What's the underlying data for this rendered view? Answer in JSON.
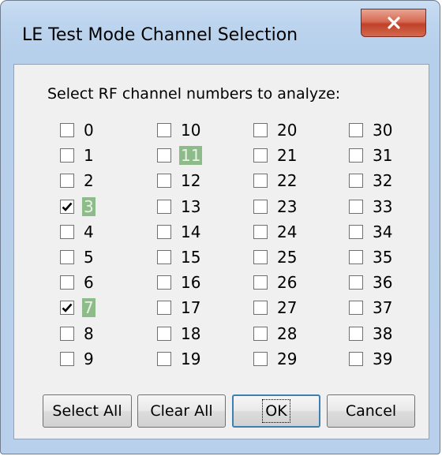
{
  "window": {
    "title": "LE Test Mode Channel Selection",
    "close_icon": "close-x"
  },
  "prompt": "Select RF channel numbers to analyze:",
  "highlight_color": "#8dbb8a",
  "columns": [
    [
      {
        "label": "0",
        "checked": false,
        "highlighted": false
      },
      {
        "label": "1",
        "checked": false,
        "highlighted": false
      },
      {
        "label": "2",
        "checked": false,
        "highlighted": false
      },
      {
        "label": "3",
        "checked": true,
        "highlighted": true
      },
      {
        "label": "4",
        "checked": false,
        "highlighted": false
      },
      {
        "label": "5",
        "checked": false,
        "highlighted": false
      },
      {
        "label": "6",
        "checked": false,
        "highlighted": false
      },
      {
        "label": "7",
        "checked": true,
        "highlighted": true
      },
      {
        "label": "8",
        "checked": false,
        "highlighted": false
      },
      {
        "label": "9",
        "checked": false,
        "highlighted": false
      }
    ],
    [
      {
        "label": "10",
        "checked": false,
        "highlighted": false
      },
      {
        "label": "11",
        "checked": false,
        "highlighted": true
      },
      {
        "label": "12",
        "checked": false,
        "highlighted": false
      },
      {
        "label": "13",
        "checked": false,
        "highlighted": false
      },
      {
        "label": "14",
        "checked": false,
        "highlighted": false
      },
      {
        "label": "15",
        "checked": false,
        "highlighted": false
      },
      {
        "label": "16",
        "checked": false,
        "highlighted": false
      },
      {
        "label": "17",
        "checked": false,
        "highlighted": false
      },
      {
        "label": "18",
        "checked": false,
        "highlighted": false
      },
      {
        "label": "19",
        "checked": false,
        "highlighted": false
      }
    ],
    [
      {
        "label": "20",
        "checked": false,
        "highlighted": false
      },
      {
        "label": "21",
        "checked": false,
        "highlighted": false
      },
      {
        "label": "22",
        "checked": false,
        "highlighted": false
      },
      {
        "label": "23",
        "checked": false,
        "highlighted": false
      },
      {
        "label": "24",
        "checked": false,
        "highlighted": false
      },
      {
        "label": "25",
        "checked": false,
        "highlighted": false
      },
      {
        "label": "26",
        "checked": false,
        "highlighted": false
      },
      {
        "label": "27",
        "checked": false,
        "highlighted": false
      },
      {
        "label": "28",
        "checked": false,
        "highlighted": false
      },
      {
        "label": "29",
        "checked": false,
        "highlighted": false
      }
    ],
    [
      {
        "label": "30",
        "checked": false,
        "highlighted": false
      },
      {
        "label": "31",
        "checked": false,
        "highlighted": false
      },
      {
        "label": "32",
        "checked": false,
        "highlighted": false
      },
      {
        "label": "33",
        "checked": false,
        "highlighted": false
      },
      {
        "label": "34",
        "checked": false,
        "highlighted": false
      },
      {
        "label": "35",
        "checked": false,
        "highlighted": false
      },
      {
        "label": "36",
        "checked": false,
        "highlighted": false
      },
      {
        "label": "37",
        "checked": false,
        "highlighted": false
      },
      {
        "label": "38",
        "checked": false,
        "highlighted": false
      },
      {
        "label": "39",
        "checked": false,
        "highlighted": false
      }
    ]
  ],
  "buttons": {
    "select_all": "Select All",
    "clear_all": "Clear All",
    "ok": "OK",
    "cancel": "Cancel"
  }
}
